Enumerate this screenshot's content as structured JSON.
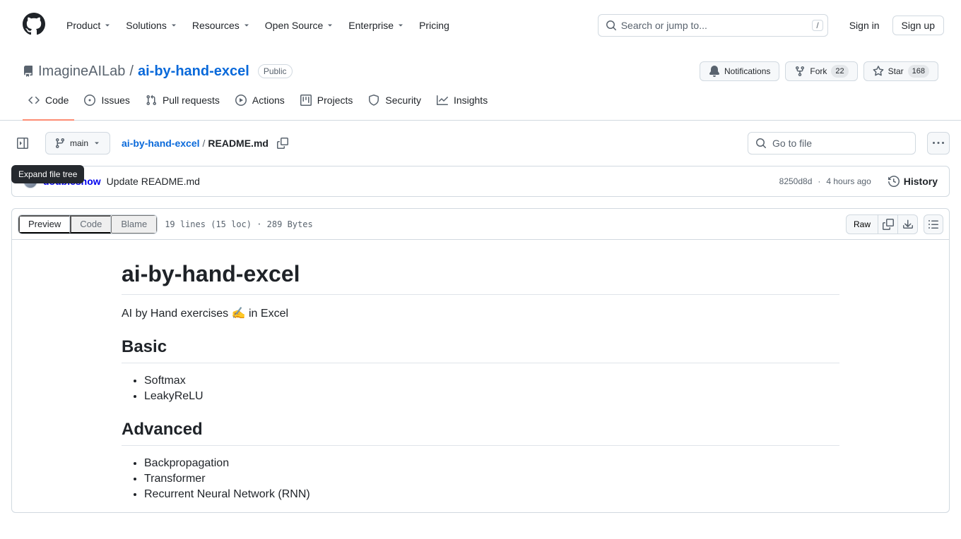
{
  "nav": {
    "items": [
      "Product",
      "Solutions",
      "Resources",
      "Open Source",
      "Enterprise",
      "Pricing"
    ],
    "search_placeholder": "Search or jump to...",
    "search_key": "/",
    "sign_in": "Sign in",
    "sign_up": "Sign up"
  },
  "repo": {
    "owner": "ImagineAILab",
    "name": "ai-by-hand-excel",
    "visibility": "Public",
    "notifications": "Notifications",
    "fork": "Fork",
    "fork_count": "22",
    "star": "Star",
    "star_count": "168"
  },
  "tabs": [
    "Code",
    "Issues",
    "Pull requests",
    "Actions",
    "Projects",
    "Security",
    "Insights"
  ],
  "file_nav": {
    "branch": "main",
    "repo_link": "ai-by-hand-excel",
    "file": "README.md",
    "go_to_file": "Go to file",
    "tooltip": "Expand file tree"
  },
  "commit": {
    "author": "doubleshow",
    "message": "Update README.md",
    "sha": "8250d8d",
    "sep": "·",
    "time": "4 hours ago",
    "history": "History"
  },
  "file_head": {
    "preview": "Preview",
    "code": "Code",
    "blame": "Blame",
    "stats": "19 lines (15 loc) · 289 Bytes",
    "raw": "Raw"
  },
  "readme": {
    "h1": "ai-by-hand-excel",
    "tagline": "AI by Hand exercises ✍️ in Excel",
    "h2_basic": "Basic",
    "basic_items": [
      "Softmax",
      "LeakyReLU"
    ],
    "h2_advanced": "Advanced",
    "advanced_items": [
      "Backpropagation",
      "Transformer",
      "Recurrent Neural Network (RNN)"
    ]
  }
}
